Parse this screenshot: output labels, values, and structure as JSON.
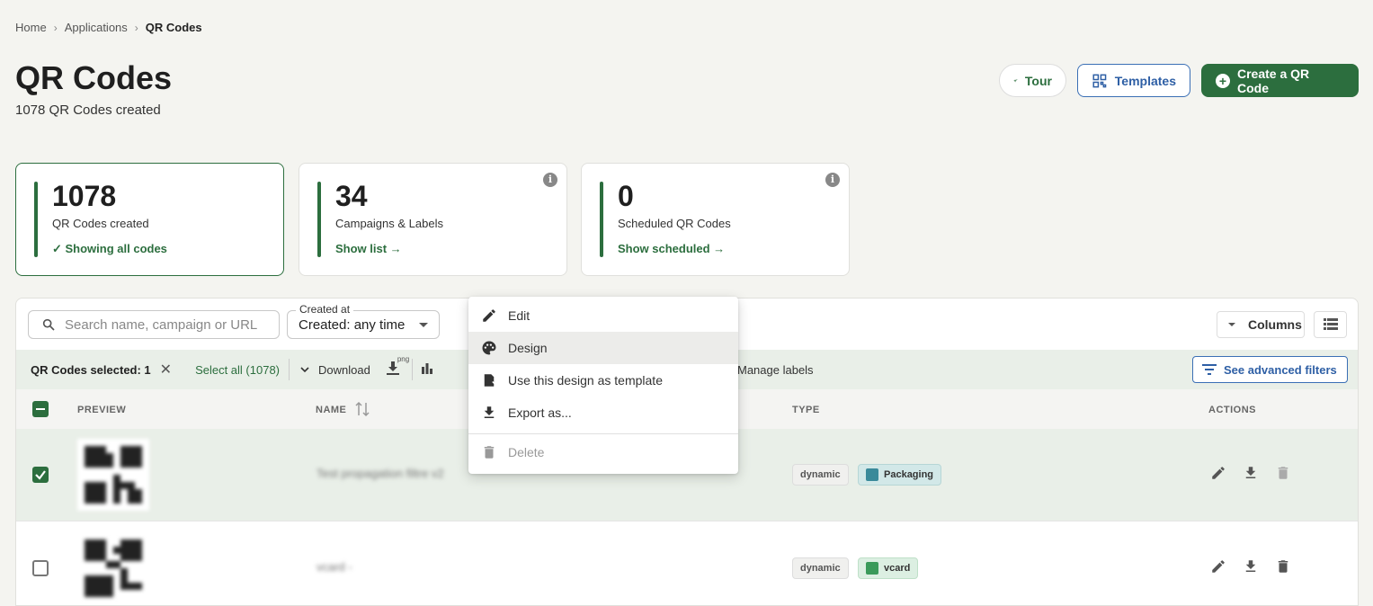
{
  "breadcrumb": [
    "Home",
    "Applications",
    "QR Codes"
  ],
  "page": {
    "title": "QR Codes",
    "subtitle": "1078 QR Codes created"
  },
  "header_buttons": {
    "tour": "Tour",
    "templates": "Templates",
    "create": "Create a QR Code"
  },
  "cards": [
    {
      "number": "1078",
      "label": "QR Codes created",
      "link": "✓ Showing all codes"
    },
    {
      "number": "34",
      "label": "Campaigns & Labels",
      "link": "Show list →"
    },
    {
      "number": "0",
      "label": "Scheduled QR Codes",
      "link": "Show scheduled →"
    }
  ],
  "toolbar": {
    "search_placeholder": "Search name, campaign or URL",
    "date_legend": "Created at",
    "date_value": "Created: any time",
    "columns": "Columns"
  },
  "selection_bar": {
    "selected": "QR Codes selected: 1",
    "select_all": "Select all (1078)",
    "download": "Download",
    "png": "png",
    "manage_labels": "Manage labels",
    "advanced_filters": "See advanced filters"
  },
  "table": {
    "headers": {
      "preview": "PREVIEW",
      "name": "NAME",
      "type": "TYPE",
      "actions": "ACTIONS"
    },
    "rows": [
      {
        "selected": true,
        "name": "Test propagation filtre v2",
        "mode": "dynamic",
        "type": "Packaging",
        "type_color": "#3a8a9a"
      },
      {
        "selected": false,
        "name": "vcard -",
        "mode": "dynamic",
        "type": "vcard",
        "type_color": "#3a9a5a"
      }
    ]
  },
  "context_menu": {
    "items": [
      {
        "label": "Edit",
        "icon": "pencil-icon"
      },
      {
        "label": "Design",
        "icon": "palette-icon"
      },
      {
        "label": "Use this design as template",
        "icon": "template-icon"
      },
      {
        "label": "Export as...",
        "icon": "download-icon"
      },
      {
        "label": "Delete",
        "icon": "trash-icon"
      }
    ]
  },
  "colors": {
    "accent": "#2c6e3e",
    "blue": "#2e5fa5",
    "selected_row": "#e9efe8"
  }
}
